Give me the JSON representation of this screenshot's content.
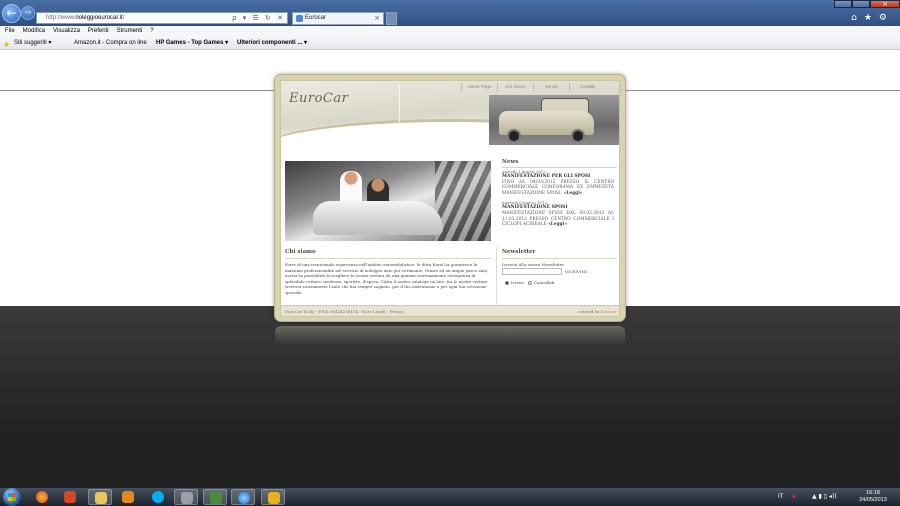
{
  "browser": {
    "address_scheme": "http://www.",
    "address_host": "noleggioeurocar.it",
    "address_rest": "/",
    "tab_title": "Eurocar",
    "addr_icons": "ρ ▾ ☰ ↻ ✕",
    "chrome_icons": "⌂★⚙",
    "menu": [
      "File",
      "Modifica",
      "Visualizza",
      "Preferiti",
      "Strumenti",
      "?"
    ],
    "favorites": [
      "Siti suggeriti ▾",
      "Amazon.it - Compra on line",
      "HP Games - Top Games ▾",
      "Ulteriori componenti ... ▾"
    ]
  },
  "site": {
    "logo": "EuroCar",
    "nav": [
      "Home Page",
      "Chi Siamo",
      "Servizi",
      "Contatti"
    ],
    "news_heading": "News",
    "news": [
      {
        "date": "giovedì 1 marzo 2012",
        "title": "MANIFESTAZIONE PER GLI SPOSI",
        "body": "FINO AL 04/03/2012 PRESSO IL CENTRO COMMERCIALE CONFORAMA EX EMMEZETA MANIFESTAZIONE SPOSI.",
        "more": "«Leggi»"
      },
      {
        "date": "martedì 6 marzo 2012",
        "title": "MANIFESTAZIONE SPOSI",
        "body": "MANIFESTAZIONE SPOSI DAL 09.03.2012 AL 11.03.2012 PRESSO CENTRO COMMERCIALE I CICLOPI ACIREALE",
        "more": "«Leggi»"
      }
    ],
    "about_heading": "Chi siamo",
    "about_text": "Forte di una trentennale esperienza nell'ambito automobilistico, la ditta EuroCar garantisce la massima professionalità nel servizio di noleggio auto per cerimonie. Grazie ad un ampio parco auto, avrete la possibilità di scegliere la vostra vettura da una gamma estremamente eterogenea di splendide vetture: moderne, sportive, d'epoca. Visita il nostro catalogo on line, tra le nostre vetture troverai sicuramente l'auto che hai sempre sognato, per il tuo matrimonio o per ogni tua occasione speciale.",
    "newsletter_heading": "Newsletter",
    "newsletter_label": "Iscriviti alla nostra Newsletter",
    "newsletter_button": "ISCRIVIMI",
    "newsletter_options": [
      "Iscrivi",
      "Cancellati"
    ],
    "footer_left": "EuroCar Sicily  -  P.IVA 00424250474  -  Note Legali  -  Privacy",
    "footer_created": "created by",
    "footer_brand": "Eurocar"
  },
  "taskbar": {
    "lang": "IT",
    "clock_time": "16:18",
    "clock_date": "24/05/2013"
  },
  "colors": {
    "frame": "#d8d4b2",
    "titlebar": "#2f4f80",
    "accent_brand": "#c48a2a"
  }
}
